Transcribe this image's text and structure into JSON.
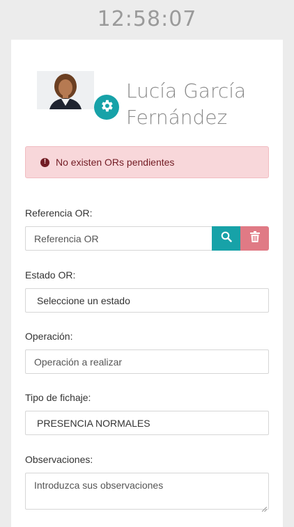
{
  "status_bar": {
    "time": "12:58:07"
  },
  "profile": {
    "name_line1": "Lucía García",
    "name_line2": "Fernández"
  },
  "alert": {
    "message": "No existen ORs pendientes"
  },
  "form": {
    "referencia": {
      "label": "Referencia OR:",
      "placeholder": "Referencia OR"
    },
    "estado": {
      "label": "Estado OR:",
      "value": "Seleccione un estado"
    },
    "operacion": {
      "label": "Operación:",
      "placeholder": "Operación a realizar"
    },
    "tipo_fichaje": {
      "label": "Tipo de fichaje:",
      "value": "PRESENCIA NORMALES"
    },
    "observaciones": {
      "label": "Observaciones:",
      "placeholder": "Introduzca sus observaciones"
    }
  },
  "colors": {
    "accent": "#17a2a8",
    "danger": "#e07a85",
    "alert_bg": "#f8d7da",
    "alert_text": "#721c24"
  },
  "icons": {
    "settings": "gear-icon",
    "search": "search-icon",
    "delete": "trash-icon",
    "alert": "exclamation-circle-icon"
  }
}
